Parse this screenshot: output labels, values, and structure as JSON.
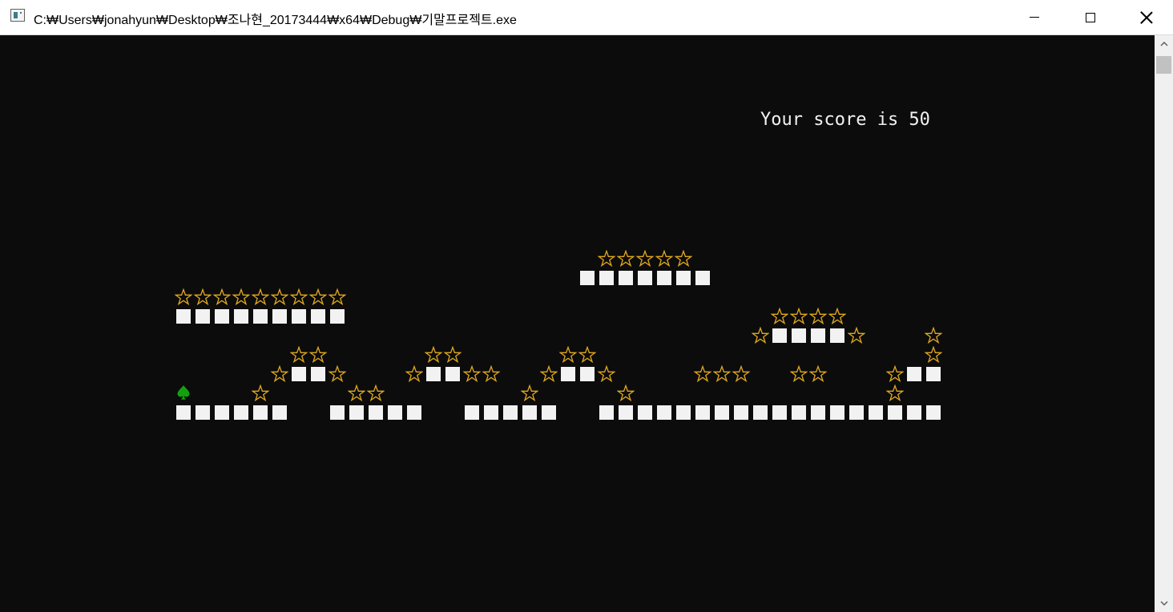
{
  "window": {
    "title": "C:₩Users₩jonahyun₩Desktop₩조나현_20173444₩x64₩Debug₩기말프로젝트.exe",
    "icon": "console-app-icon",
    "controls": [
      "minimize-icon",
      "maximize-icon",
      "close-icon"
    ]
  },
  "game": {
    "score_text": "Your score is 50",
    "player_icon": "spade-icon",
    "colors": {
      "background": "#0c0c0c",
      "block": "#f2f2f2",
      "star": "#e0a81f",
      "player": "#13a10e",
      "score_text": "#f2f2f2"
    }
  },
  "scrollbar": {
    "icons": [
      "scroll-up-arrow-icon",
      "scroll-down-arrow-icon"
    ]
  }
}
